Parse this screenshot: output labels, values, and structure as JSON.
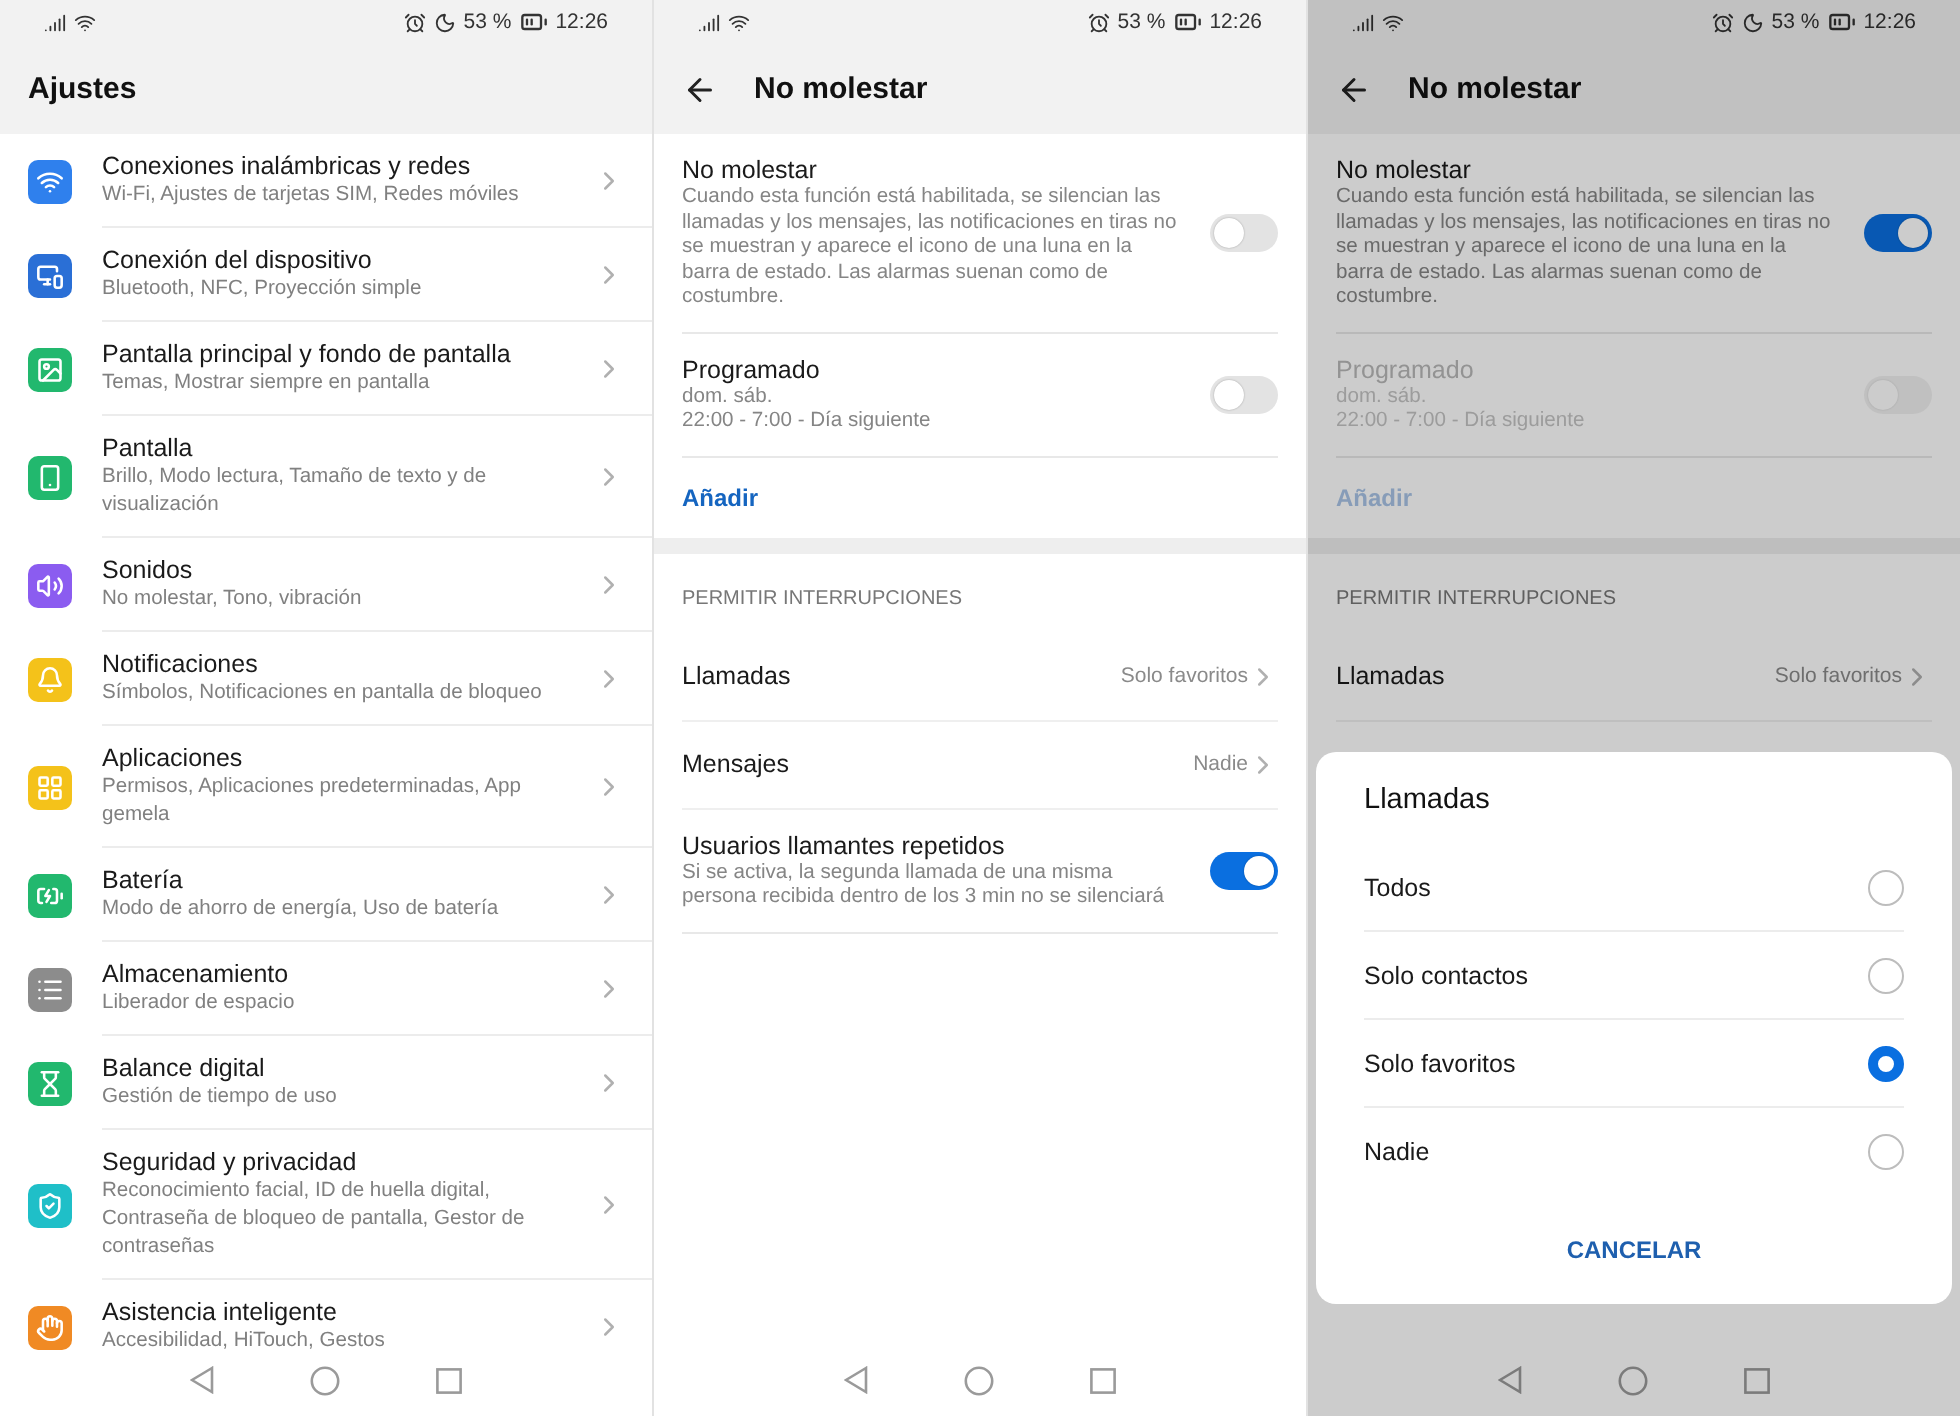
{
  "screens": [
    {
      "kind": "settings_list",
      "status_bar": {
        "moon": true,
        "battery": "53 %",
        "time": "12:26"
      },
      "title": "Ajustes",
      "items": [
        {
          "title": "Conexiones inalámbricas y redes",
          "subtitle": "Wi-Fi, Ajustes de tarjetas SIM, Redes móviles",
          "color": "#2f80ed"
        },
        {
          "title": "Conexión del dispositivo",
          "subtitle": "Bluetooth, NFC, Proyección simple",
          "color": "#2a6fd6"
        },
        {
          "title": "Pantalla principal y fondo de pantalla",
          "subtitle": "Temas, Mostrar siempre en pantalla",
          "color": "#22b86e"
        },
        {
          "title": "Pantalla",
          "subtitle": "Brillo, Modo lectura, Tamaño de texto y de visualización",
          "color": "#22b86e"
        },
        {
          "title": "Sonidos",
          "subtitle": "No molestar, Tono, vibración",
          "color": "#8b5cf0"
        },
        {
          "title": "Notificaciones",
          "subtitle": "Símbolos, Notificaciones en pantalla de bloqueo",
          "color": "#f4c21a"
        },
        {
          "title": "Aplicaciones",
          "subtitle": "Permisos, Aplicaciones predeterminadas, App gemela",
          "color": "#f4c21a"
        },
        {
          "title": "Batería",
          "subtitle": "Modo de ahorro de energía, Uso de batería",
          "color": "#22b86e"
        },
        {
          "title": "Almacenamiento",
          "subtitle": "Liberador de espacio",
          "color": "#8c8c8c"
        },
        {
          "title": "Balance digital",
          "subtitle": "Gestión de tiempo de uso",
          "color": "#22b86e"
        },
        {
          "title": "Seguridad y privacidad",
          "subtitle": "Reconocimiento facial, ID de huella digital, Contraseña de bloqueo de pantalla, Gestor de contraseñas",
          "color": "#1fbfc8"
        },
        {
          "title": "Asistencia inteligente",
          "subtitle": "Accesibilidad, HiTouch, Gestos",
          "color": "#f08a24"
        }
      ]
    },
    {
      "kind": "do_not_disturb",
      "status_bar": {
        "moon": false,
        "battery": "53 %",
        "time": "12:26"
      },
      "title": "No molestar",
      "items": [
        {
          "kind": "switch",
          "title": "No molestar",
          "description": "Cuando esta función está habilitada, se silencian las llamadas y los mensajes, las notificaciones en tiras no se muestran y aparece el icono de una luna en la barra de estado. Las alarmas suenan como de costumbre.",
          "on": false,
          "disabled": false
        },
        {
          "kind": "switch",
          "title": "Programado",
          "details": [
            "dom. sáb.",
            "22:00 - 7:00 - Día siguiente"
          ],
          "on": false,
          "disabled": false
        },
        {
          "kind": "link",
          "label": "Añadir",
          "disabled": false
        },
        {
          "kind": "section",
          "label": "PERMITIR INTERRUPCIONES"
        },
        {
          "kind": "choice",
          "label": "Llamadas",
          "value": "Solo favoritos"
        },
        {
          "kind": "choice",
          "label": "Mensajes",
          "value": "Nadie"
        },
        {
          "kind": "switch",
          "title": "Usuarios llamantes repetidos",
          "description": "Si se activa, la segunda llamada de una misma persona recibida dentro de los 3 min no se silenciará",
          "on": true,
          "disabled": false
        }
      ]
    },
    {
      "kind": "do_not_disturb",
      "status_bar": {
        "moon": true,
        "battery": "53 %",
        "time": "12:26"
      },
      "title": "No molestar",
      "items": [
        {
          "kind": "switch",
          "title": "No molestar",
          "description": "Cuando esta función está habilitada, se silencian las llamadas y los mensajes, las notificaciones en tiras no se muestran y aparece el icono de una luna en la barra de estado. Las alarmas suenan como de costumbre.",
          "on": true,
          "disabled": false
        },
        {
          "kind": "switch",
          "title": "Programado",
          "details": [
            "dom. sáb.",
            "22:00 - 7:00 - Día siguiente"
          ],
          "on": false,
          "disabled": true
        },
        {
          "kind": "link",
          "label": "Añadir",
          "disabled": true
        },
        {
          "kind": "section",
          "label": "PERMITIR INTERRUPCIONES"
        },
        {
          "kind": "choice",
          "label": "Llamadas",
          "value": "Solo favoritos"
        }
      ],
      "dialog": {
        "title": "Llamadas",
        "options": [
          {
            "label": "Todos",
            "selected": false
          },
          {
            "label": "Solo contactos",
            "selected": false
          },
          {
            "label": "Solo favoritos",
            "selected": true
          },
          {
            "label": "Nadie",
            "selected": false
          }
        ],
        "cancel": "CANCELAR"
      }
    }
  ]
}
